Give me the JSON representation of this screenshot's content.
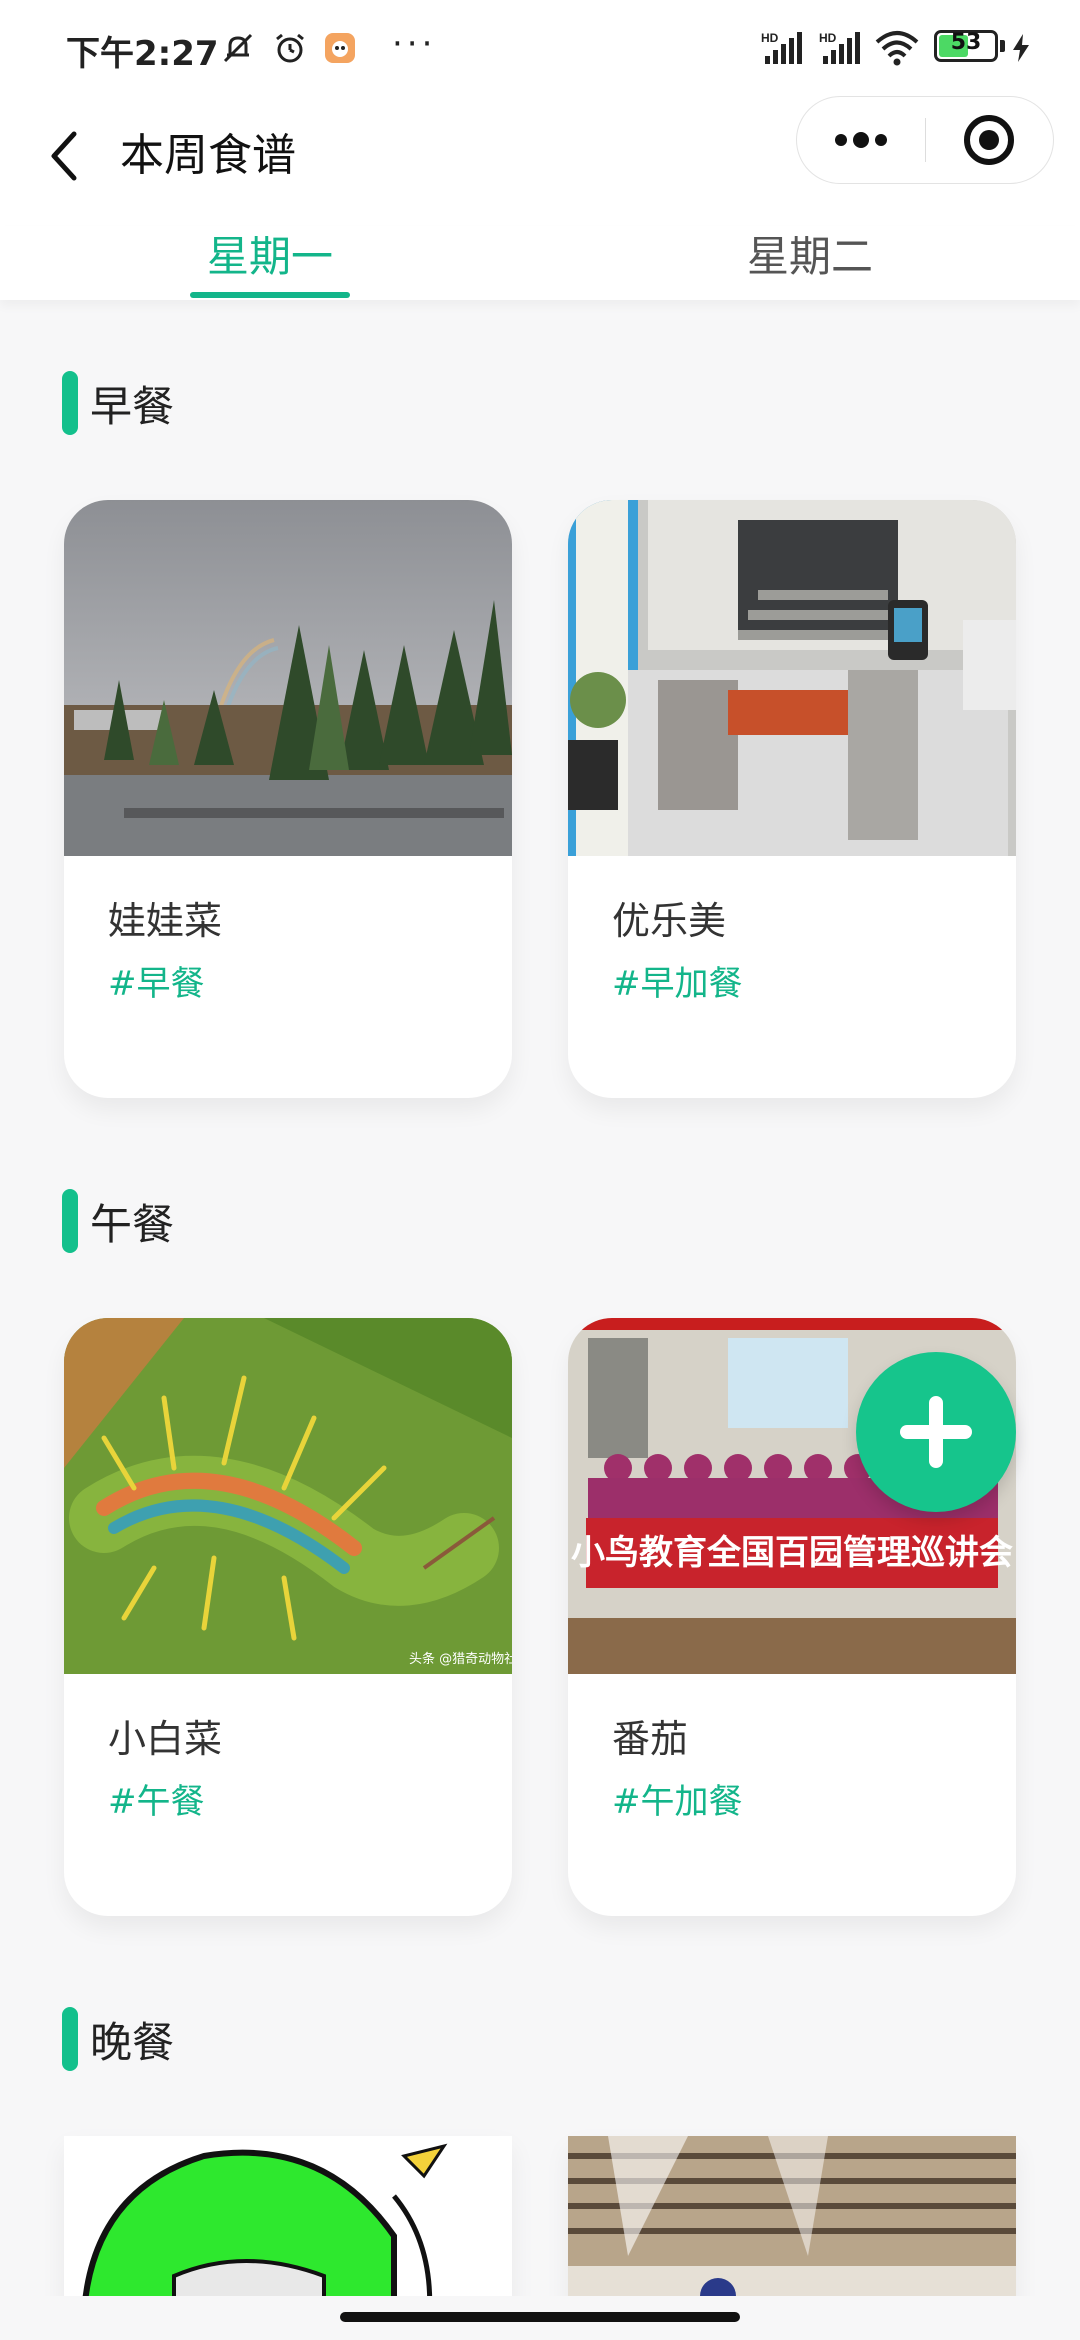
{
  "status_bar": {
    "time": "下午2:27",
    "battery": "53",
    "battery_level": 0.53,
    "icons": [
      "mute-bell-icon",
      "alarm-icon",
      "app-notification-icon",
      "more-dots-icon",
      "signal-hd-1-icon",
      "signal-hd-2-icon",
      "wifi-icon",
      "battery-icon",
      "charging-icon"
    ],
    "network_labels": [
      "HD",
      "HD"
    ]
  },
  "navbar": {
    "title": "本周食谱",
    "icons": [
      "back-arrow-icon",
      "more-dots-icon",
      "record-target-icon"
    ]
  },
  "tabs": [
    {
      "label": "星期一",
      "active": true
    },
    {
      "label": "星期二",
      "active": false
    }
  ],
  "sections": [
    {
      "title": "早餐",
      "cards": [
        {
          "name": "娃娃菜",
          "tag": "#早餐",
          "image": "rainbow-trees-photo"
        },
        {
          "name": "优乐美",
          "tag": "#早加餐",
          "image": "school-entrance-gate-photo"
        }
      ]
    },
    {
      "title": "午餐",
      "cards": [
        {
          "name": "小白菜",
          "tag": "#午餐",
          "image": "caterpillar-photo",
          "watermark": "头条 @猎奇动物社"
        },
        {
          "name": "番茄",
          "tag": "#午加餐",
          "image": "group-photo-banner",
          "banner": "小鸟教育全国百园管理巡讲会"
        }
      ]
    },
    {
      "title": "晚餐",
      "cards": [
        {
          "image": "green-cartoon-meme-photo"
        },
        {
          "image": "classroom-ceiling-photo"
        }
      ]
    }
  ],
  "fab": {
    "icon": "plus-icon"
  },
  "colors": {
    "accent": "#13b58a",
    "fab": "#16c58c",
    "background": "#f7f7f8"
  }
}
